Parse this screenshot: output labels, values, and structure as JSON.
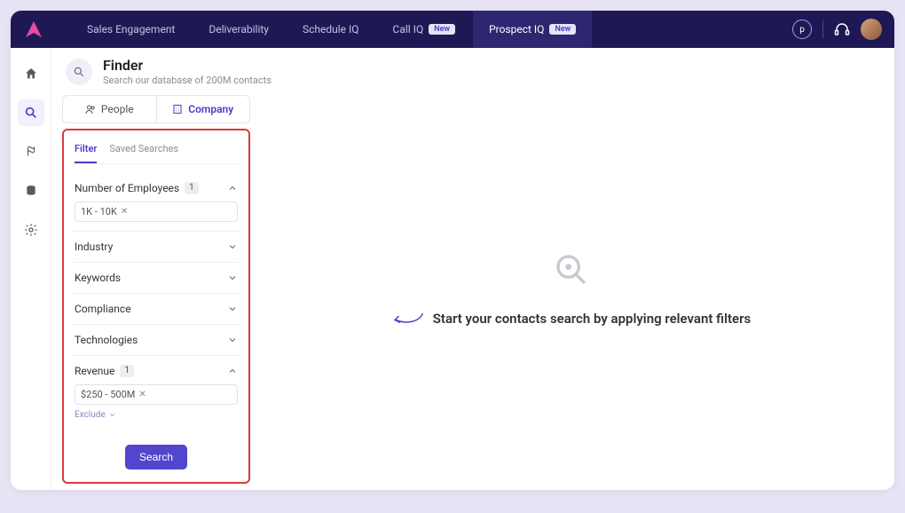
{
  "nav": {
    "items": [
      {
        "label": "Sales Engagement",
        "badge": null
      },
      {
        "label": "Deliverability",
        "badge": null
      },
      {
        "label": "Schedule IQ",
        "badge": null
      },
      {
        "label": "Call IQ",
        "badge": "New"
      },
      {
        "label": "Prospect IQ",
        "badge": "New"
      }
    ],
    "avatar_letter": "p"
  },
  "page": {
    "title": "Finder",
    "subtitle": "Search our database of 200M contacts"
  },
  "seg_tabs": {
    "people": "People",
    "company": "Company"
  },
  "filter_tabs": {
    "filter": "Filter",
    "saved": "Saved Searches"
  },
  "filters": {
    "employees": {
      "label": "Number of Employees",
      "count": "1",
      "chip": "1K - 10K"
    },
    "industry": {
      "label": "Industry"
    },
    "keywords": {
      "label": "Keywords"
    },
    "compliance": {
      "label": "Compliance"
    },
    "technologies": {
      "label": "Technologies"
    },
    "revenue": {
      "label": "Revenue",
      "count": "1",
      "chip": "$250 - 500M"
    },
    "exclude": "Exclude",
    "search_btn": "Search"
  },
  "empty_state": {
    "text": "Start your contacts search by applying relevant filters"
  }
}
